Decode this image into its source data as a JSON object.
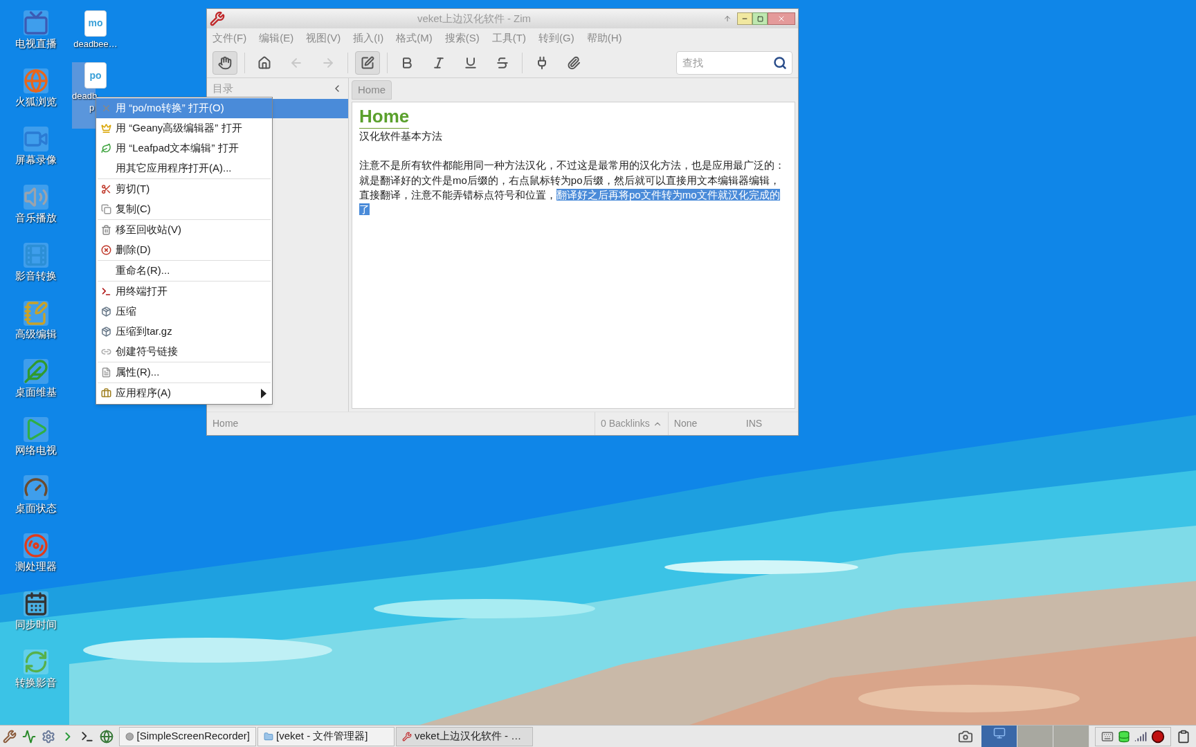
{
  "desktop": {
    "icons": [
      {
        "label": "电视直播"
      },
      {
        "label": "火狐浏览"
      },
      {
        "label": "屏幕录像"
      },
      {
        "label": "音乐播放"
      },
      {
        "label": "影音转换"
      },
      {
        "label": "高级编辑"
      },
      {
        "label": "桌面维基"
      },
      {
        "label": "网络电视"
      },
      {
        "label": "桌面状态"
      },
      {
        "label": "测处理器"
      },
      {
        "label": "同步时间"
      },
      {
        "label": "转换影音"
      }
    ],
    "files": [
      {
        "badge": "mo",
        "label_lines": [
          "deadbee…"
        ],
        "selected": false
      },
      {
        "badge": "po",
        "label_lines": [
          "deadb",
          "p"
        ],
        "selected": true
      }
    ]
  },
  "zim_window": {
    "title": "veket上边汉化软件  -  Zim",
    "menu": [
      "文件(F)",
      "编辑(E)",
      "视图(V)",
      "插入(I)",
      "格式(M)",
      "搜索(S)",
      "工具(T)",
      "转到(G)",
      "帮助(H)"
    ],
    "toolbar": [
      {
        "kind": "button",
        "on": true,
        "disabled": false
      },
      {
        "kind": "separator"
      },
      {
        "kind": "button",
        "on": false,
        "disabled": false
      },
      {
        "kind": "button",
        "on": false,
        "disabled": true
      },
      {
        "kind": "button",
        "on": false,
        "disabled": true
      },
      {
        "kind": "separator"
      },
      {
        "kind": "button",
        "on": true,
        "disabled": false
      },
      {
        "kind": "separator"
      },
      {
        "kind": "button",
        "on": false,
        "disabled": false
      },
      {
        "kind": "button",
        "on": false,
        "disabled": false
      },
      {
        "kind": "button",
        "on": false,
        "disabled": false
      },
      {
        "kind": "button",
        "on": false,
        "disabled": false
      },
      {
        "kind": "separator"
      },
      {
        "kind": "button",
        "on": false,
        "disabled": false
      },
      {
        "kind": "button",
        "on": false,
        "disabled": false
      }
    ],
    "search": {
      "placeholder": "查找"
    },
    "sidebar": {
      "title": "目录"
    },
    "pathbar": [
      {
        "label": "Home",
        "selected": true
      }
    ],
    "page": {
      "heading": "Home",
      "paragraphs": [
        {
          "text": "汉化软件基本方法",
          "space_before": false
        },
        {
          "text": "注意不是所有软件都能用同一种方法汉化，不过这是最常用的汉化方法，也是应用最广泛的：",
          "space_before": true
        },
        {
          "text": "就是翻译好的文件是mo后缀的，右点鼠标转为po后缀，然后就可以直接用文本编辑器编辑，直接翻译，注意不能弄错标点符号和位置，",
          "selection": "翻译好之后再将po文件转为mo文件就汉化完成的了",
          "space_before": false
        }
      ]
    },
    "status_bar": {
      "page": "Home",
      "backlinks": "0 Backlinks",
      "style": "None",
      "mode": "INS"
    }
  },
  "context_menu": {
    "items": [
      {
        "kind": "item",
        "label": "用 “po/mo转换” 打开(O)",
        "selected": true,
        "submenu": false
      },
      {
        "kind": "item",
        "label": "用 “Geany高级编辑器” 打开",
        "selected": false,
        "submenu": false
      },
      {
        "kind": "item",
        "label": "用 “Leafpad文本编辑” 打开",
        "selected": false,
        "submenu": false
      },
      {
        "kind": "item",
        "label": "用其它应用程序打开(A)...",
        "selected": false,
        "submenu": false
      },
      {
        "kind": "separator"
      },
      {
        "kind": "item",
        "label": "剪切(T)",
        "selected": false,
        "submenu": false
      },
      {
        "kind": "item",
        "label": "复制(C)",
        "selected": false,
        "submenu": false
      },
      {
        "kind": "separator"
      },
      {
        "kind": "item",
        "label": "移至回收站(V)",
        "selected": false,
        "submenu": false
      },
      {
        "kind": "item",
        "label": "删除(D)",
        "selected": false,
        "submenu": false
      },
      {
        "kind": "separator"
      },
      {
        "kind": "item",
        "label": "重命名(R)...",
        "selected": false,
        "submenu": false
      },
      {
        "kind": "separator"
      },
      {
        "kind": "item",
        "label": "用终端打开",
        "selected": false,
        "submenu": false
      },
      {
        "kind": "item",
        "label": "压缩",
        "selected": false,
        "submenu": false
      },
      {
        "kind": "item",
        "label": "压缩到tar.gz",
        "selected": false,
        "submenu": false
      },
      {
        "kind": "item",
        "label": "创建符号链接",
        "selected": false,
        "submenu": false
      },
      {
        "kind": "separator"
      },
      {
        "kind": "item",
        "label": "属性(R)...",
        "selected": false,
        "submenu": false
      },
      {
        "kind": "separator"
      },
      {
        "kind": "item",
        "label": "应用程序(A)",
        "selected": false,
        "submenu": true
      }
    ]
  },
  "taskbar": {
    "tasks": [
      {
        "label": "[SimpleScreenRecorder]",
        "selected": false
      },
      {
        "label": "[veket - 文件管理器]",
        "selected": false
      },
      {
        "label": "veket上边汉化软件 - …",
        "selected": true
      }
    ],
    "workspaces": [
      {
        "selected": true
      },
      {
        "selected": false
      },
      {
        "selected": false
      }
    ]
  }
}
